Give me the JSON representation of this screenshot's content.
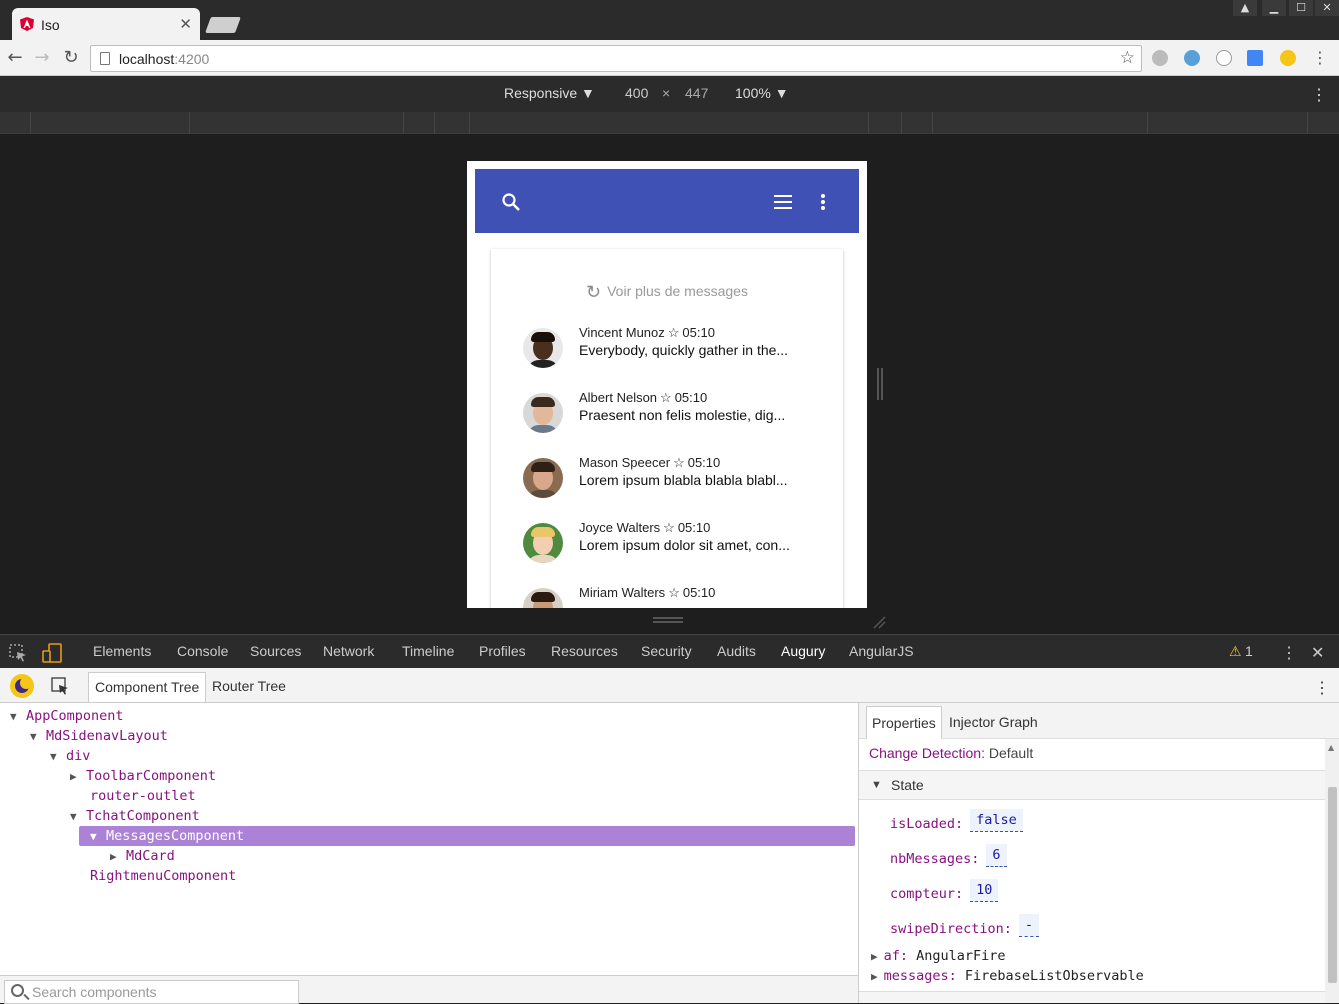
{
  "browser": {
    "tab_title": "Iso",
    "tab_close": "✕",
    "url_host": "localhost",
    "url_port": ":4200"
  },
  "device_toolbar": {
    "mode": "Responsive ▼",
    "width": "400",
    "times": "×",
    "height": "447",
    "zoom": "100% ▼"
  },
  "app": {
    "load_more": "Voir plus de messages",
    "messages": [
      {
        "author": "Vincent Munoz",
        "time": "05:10",
        "text": "Everybody, quickly gather in the..."
      },
      {
        "author": "Albert Nelson",
        "time": "05:10",
        "text": "Praesent non felis molestie, dig..."
      },
      {
        "author": "Mason Speecer",
        "time": "05:10",
        "text": "Lorem ipsum blabla blabla blabl..."
      },
      {
        "author": "Joyce Walters",
        "time": "05:10",
        "text": "Lorem ipsum dolor sit amet, con..."
      },
      {
        "author": "Miriam Walters",
        "time": "05:10",
        "text": ""
      }
    ]
  },
  "devtools": {
    "tabs": [
      "Elements",
      "Console",
      "Sources",
      "Network",
      "Timeline",
      "Profiles",
      "Resources",
      "Security",
      "Audits",
      "Augury",
      "AngularJS"
    ],
    "active_tab": "Augury",
    "warning_count": "1",
    "augury_tabs": [
      "Component Tree",
      "Router Tree"
    ],
    "tree": [
      {
        "label": "AppComponent",
        "expanded": true
      },
      {
        "label": "MdSidenavLayout",
        "expanded": true
      },
      {
        "label": "div",
        "expanded": true
      },
      {
        "label": "ToolbarComponent",
        "expanded": false
      },
      {
        "label": "router-outlet"
      },
      {
        "label": "TchatComponent",
        "expanded": true
      },
      {
        "label": "MessagesComponent",
        "expanded": true,
        "selected": true
      },
      {
        "label": "MdCard",
        "expanded": false
      },
      {
        "label": "RightmenuComponent"
      }
    ],
    "search_placeholder": "Search components",
    "props_tabs": [
      "Properties",
      "Injector Graph"
    ],
    "change_detection_key": "Change Detection:",
    "change_detection_value": "Default",
    "state_label": "State",
    "state": [
      {
        "key": "isLoaded:",
        "value": "false"
      },
      {
        "key": "nbMessages:",
        "value": "6"
      },
      {
        "key": "compteur:",
        "value": "10"
      },
      {
        "key": "swipeDirection:",
        "value": "-"
      }
    ],
    "objects": [
      {
        "key": "af:",
        "value": "AngularFire"
      },
      {
        "key": "messages:",
        "value": "FirebaseListObservable"
      }
    ]
  },
  "colors": {
    "app_toolbar": "#3f51b5",
    "selected_node": "#ab82d6",
    "active_tab_underline": "#e49b1b",
    "component_name": "#881280"
  }
}
